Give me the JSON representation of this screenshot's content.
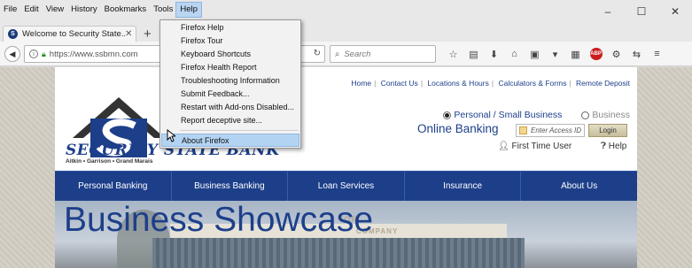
{
  "menubar": {
    "items": [
      "File",
      "Edit",
      "View",
      "History",
      "Bookmarks",
      "Tools",
      "Help"
    ],
    "active": "Help"
  },
  "window": {
    "minimize": "–",
    "maximize": "☐",
    "close": "✕"
  },
  "tab": {
    "title": "Welcome to Security State...",
    "close": "✕",
    "new_tab": "+"
  },
  "navbar": {
    "url": "https://www.ssbmn.com",
    "search_placeholder": "Search",
    "adblock_label": "ABP"
  },
  "help_menu": {
    "items": [
      "Firefox Help",
      "Firefox Tour",
      "Keyboard Shortcuts",
      "Firefox Health Report",
      "Troubleshooting Information",
      "Submit Feedback...",
      "Restart with Add-ons Disabled...",
      "Report deceptive site...",
      "About Firefox"
    ],
    "hovered": "About Firefox"
  },
  "site": {
    "logo_text": "SECURITY STATE BANK",
    "logo_sub": "Aitkin • Garrison • Grand Marais",
    "top_links": [
      "Home",
      "Contact Us",
      "Locations & Hours",
      "Calculators & Forms",
      "Remote Deposit"
    ],
    "radio_personal": "Personal / Small Business",
    "radio_business": "Business",
    "online_banking": "Online Banking",
    "access_placeholder": "Enter Access ID",
    "login": "Login",
    "first_time_user": "First Time User",
    "help": "Help",
    "nav": [
      "Personal Banking",
      "Business Banking",
      "Loan Services",
      "Insurance",
      "About Us"
    ],
    "hero_title": "Business Showcase",
    "hero_sign": "COMPANY",
    "hero_sign_partial": "TOR"
  }
}
